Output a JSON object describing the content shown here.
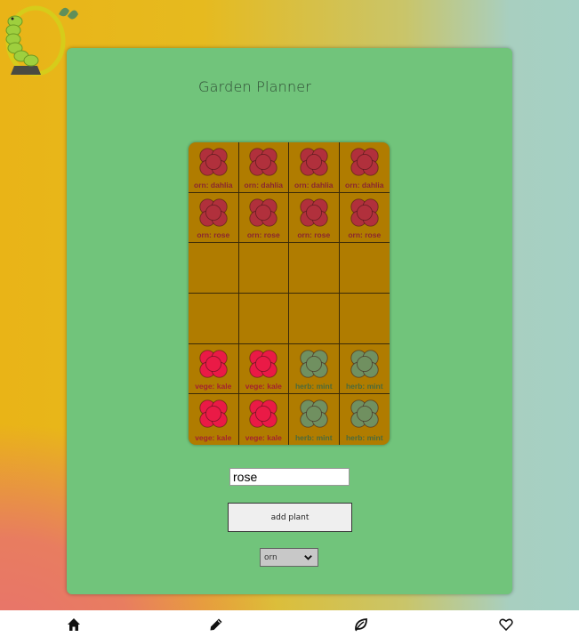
{
  "app": {
    "title": "Garden Planner"
  },
  "grid": {
    "columns": 4,
    "rows": 6,
    "cells": [
      {
        "label": "orn: dahlia",
        "flower": "dark-red"
      },
      {
        "label": "orn: dahlia",
        "flower": "dark-red"
      },
      {
        "label": "orn: dahlia",
        "flower": "dark-red"
      },
      {
        "label": "orn: dahlia",
        "flower": "dark-red"
      },
      {
        "label": "orn: rose",
        "flower": "dark-red"
      },
      {
        "label": "orn: rose",
        "flower": "dark-red"
      },
      {
        "label": "orn: rose",
        "flower": "dark-red"
      },
      {
        "label": "orn: rose",
        "flower": "dark-red"
      },
      {
        "label": "",
        "flower": ""
      },
      {
        "label": "",
        "flower": ""
      },
      {
        "label": "",
        "flower": ""
      },
      {
        "label": "",
        "flower": ""
      },
      {
        "label": "",
        "flower": ""
      },
      {
        "label": "",
        "flower": ""
      },
      {
        "label": "",
        "flower": ""
      },
      {
        "label": "",
        "flower": ""
      },
      {
        "label": "vege: kale",
        "flower": "red"
      },
      {
        "label": "vege: kale",
        "flower": "red"
      },
      {
        "label": "herb: mint",
        "flower": "green"
      },
      {
        "label": "herb: mint",
        "flower": "green"
      },
      {
        "label": "vege: kale",
        "flower": "red"
      },
      {
        "label": "vege: kale",
        "flower": "red"
      },
      {
        "label": "herb: mint",
        "flower": "green"
      },
      {
        "label": "herb: mint",
        "flower": "green"
      }
    ]
  },
  "form": {
    "plant_input_value": "rose",
    "add_button_label": "add plant",
    "type_select_value": "orn"
  },
  "nav": {
    "items": [
      {
        "icon": "home-icon"
      },
      {
        "icon": "pencil-icon"
      },
      {
        "icon": "leaf-icon"
      },
      {
        "icon": "heart-icon"
      }
    ]
  },
  "colors": {
    "card": "#71c47b",
    "bed": "#b07c00",
    "dark-red": {
      "fill": "#b1303c",
      "label": "#8a2630"
    },
    "red": {
      "fill": "#ea1a46",
      "label": "#a3222f"
    },
    "green": {
      "fill": "#709060",
      "label": "#4a6a3c"
    }
  }
}
